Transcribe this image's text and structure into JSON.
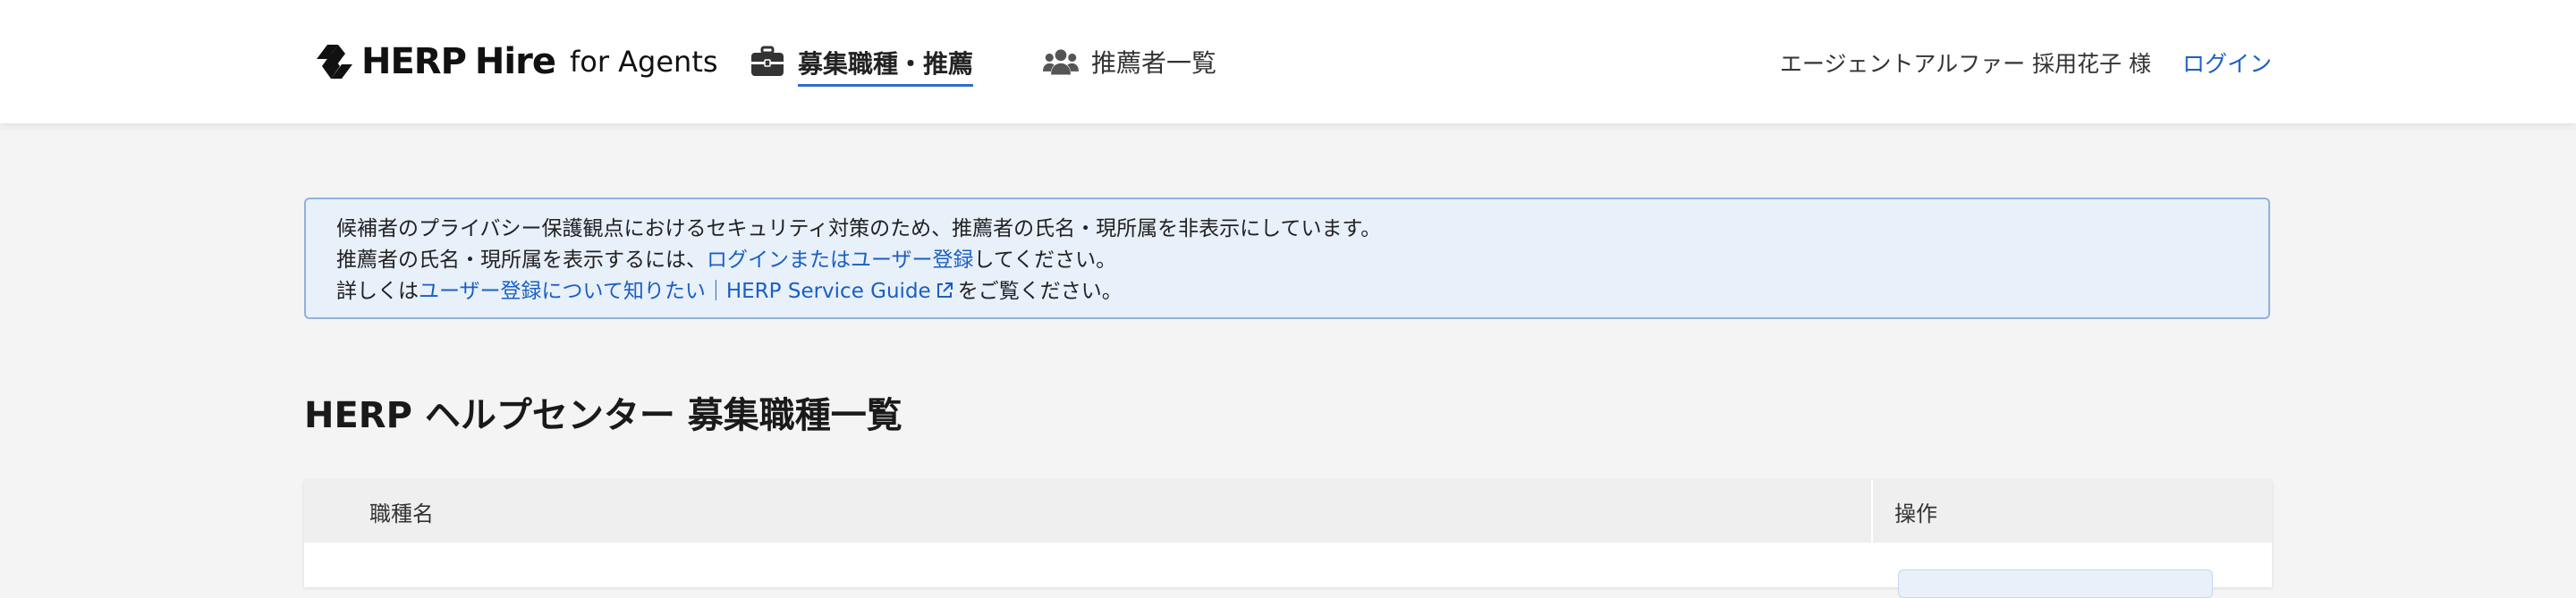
{
  "header": {
    "logo": {
      "herp": "HERP",
      "hire": "Hire",
      "for_agents": "for Agents"
    },
    "nav": {
      "jobs_label": "募集職種・推薦",
      "recommended_label": "推薦者一覧"
    },
    "user_name": "エージェントアルファー 採用花子 様",
    "login_label": "ログイン"
  },
  "notice": {
    "line1": "候補者のプライバシー保護観点におけるセキュリティ対策のため、推薦者の氏名・現所属を非表示にしています。",
    "line2_before": "推薦者の氏名・現所属を表示するには、",
    "line2_link": "ログインまたはユーザー登録",
    "line2_after": "してください。",
    "line3_before": "詳しくは",
    "line3_link": "ユーザー登録について知りたい｜HERP Service Guide",
    "line3_after": "をご覧ください。"
  },
  "page_title": "HERP ヘルプセンター 募集職種一覧",
  "table": {
    "columns": [
      "職種名",
      "操作"
    ]
  },
  "colors": {
    "accent": "#1a5fc4",
    "notice_bg": "#e8f0fa",
    "notice_border": "#8fb1e0",
    "page_bg": "#f4f4f4"
  },
  "icons": {
    "logo": "herp-logo-icon",
    "jobs": "briefcase-icon",
    "recommended": "users-icon",
    "external": "external-link-icon"
  }
}
